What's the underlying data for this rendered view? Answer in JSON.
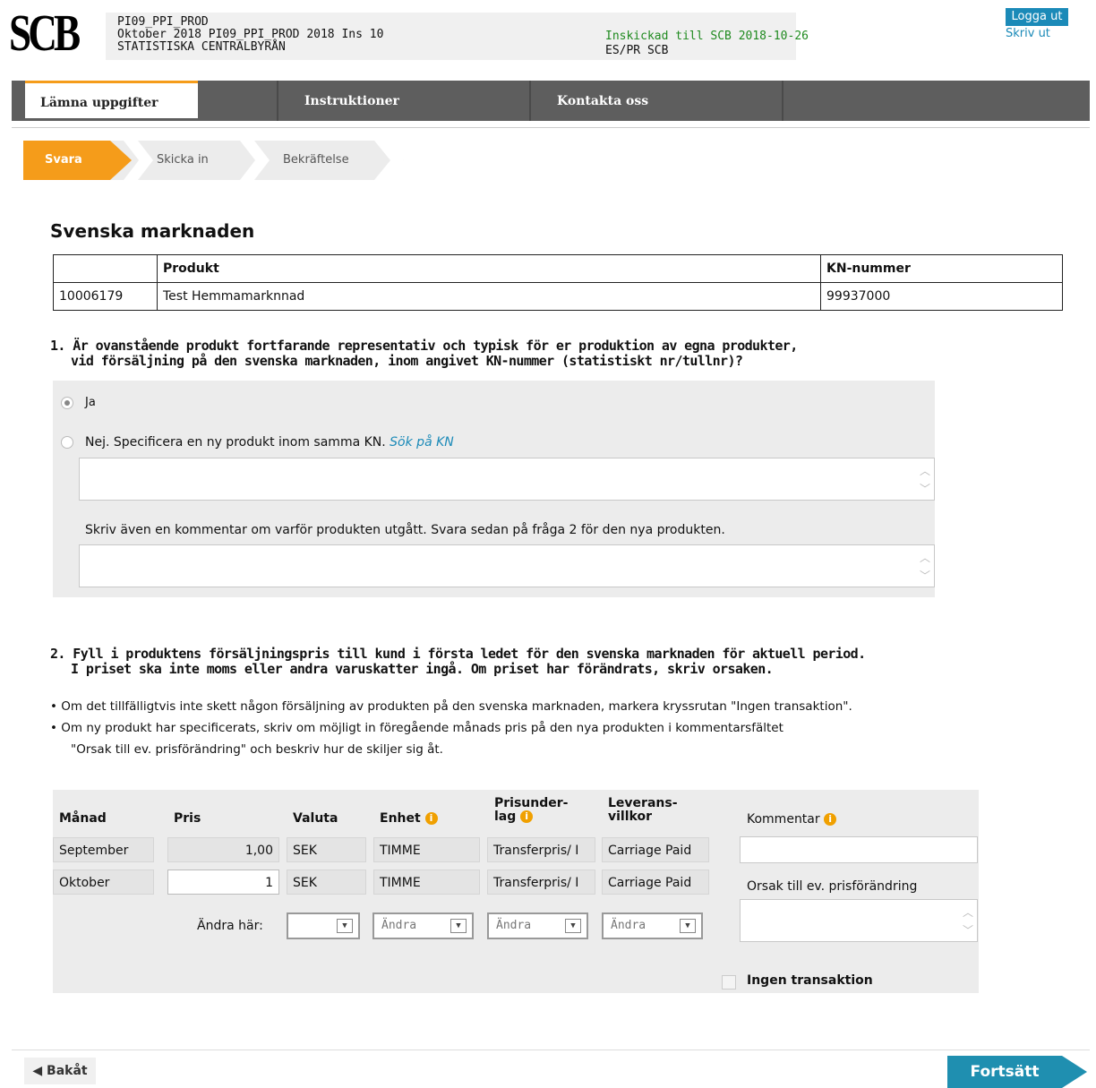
{
  "header": {
    "logo_text": "SCB",
    "line1": "PI09_PPI_PROD",
    "line2": "Oktober 2018 PI09_PPI_PROD 2018 Ins 10",
    "line3": "STATISTISKA CENTRALBYRÅN",
    "status": "Inskickad till SCB 2018-10-26",
    "unit": "ES/PR SCB",
    "logout": "Logga ut",
    "print": "Skriv ut"
  },
  "nav": {
    "tabs": [
      {
        "label": "Lämna uppgifter"
      },
      {
        "label": "Instruktioner"
      },
      {
        "label": "Kontakta oss"
      }
    ]
  },
  "steps": [
    {
      "label": "Svara"
    },
    {
      "label": "Skicka in"
    },
    {
      "label": "Bekräftelse"
    }
  ],
  "section_title": "Svenska marknaden",
  "product_table": {
    "headers": [
      "",
      "Produkt",
      "KN-nummer"
    ],
    "row": [
      "10006179",
      "Test Hemmamarknnad",
      "99937000"
    ]
  },
  "q1": {
    "line1": "1. Är ovanstående produkt fortfarande representativ och typisk för er produktion av egna produkter,",
    "line2": "vid försäljning på den svenska marknaden, inom angivet KN-nummer (statistiskt nr/tullnr)?",
    "option_yes": "Ja",
    "option_no": "Nej. Specificera en ny produkt inom samma KN.",
    "search_link": "Sök på KN",
    "comment_hint": "Skriv även en kommentar om varför produkten utgått. Svara sedan på fråga 2 för den nya produkten."
  },
  "q2": {
    "line1": "2. Fyll i produktens försäljningspris till kund i första ledet för den svenska marknaden för aktuell period.",
    "line2": "I priset ska inte moms eller andra varuskatter ingå. Om priset har förändrats, skriv orsaken.",
    "bullet1": "• Om det tillfälligtvis inte skett någon försäljning av produkten på den svenska marknaden, markera kryssrutan \"Ingen transaktion\".",
    "bullet2": "• Om ny produkt har specificerats, skriv om möjligt in föregående månads pris på den nya produkten i kommentarsfältet",
    "bullet3": "\"Orsak till ev. prisförändring\" och beskriv hur de skiljer sig åt."
  },
  "price_grid": {
    "headers": {
      "month": "Månad",
      "price": "Pris",
      "currency": "Valuta",
      "unit": "Enhet",
      "basis_1": "Prisunder-",
      "basis_2": "lag",
      "terms_1": "Leverans-",
      "terms_2": "villkor",
      "comment": "Kommentar"
    },
    "rows": [
      {
        "month": "September",
        "price": "1,00",
        "currency": "SEK",
        "unit": "TIMME",
        "basis": "Transferpris/ I",
        "terms": "Carriage Paid "
      },
      {
        "month": "Oktober",
        "price": "1",
        "currency": "SEK",
        "unit": "TIMME",
        "basis": "Transferpris/ I",
        "terms": "Carriage Paid "
      }
    ],
    "change_label": "Ändra här:",
    "change_placeholder": "Ändra",
    "reason_label": "Orsak till ev. prisförändring",
    "no_transaction": "Ingen transaktion",
    "info_glyph": "i"
  },
  "footer": {
    "back": "◀ Bakåt",
    "next": "Fortsätt"
  },
  "colors": {
    "accent_orange": "#f59c1a",
    "link_blue": "#1b8ab8",
    "status_green": "#1f8a1f",
    "nav_grey": "#5e5e5e"
  }
}
